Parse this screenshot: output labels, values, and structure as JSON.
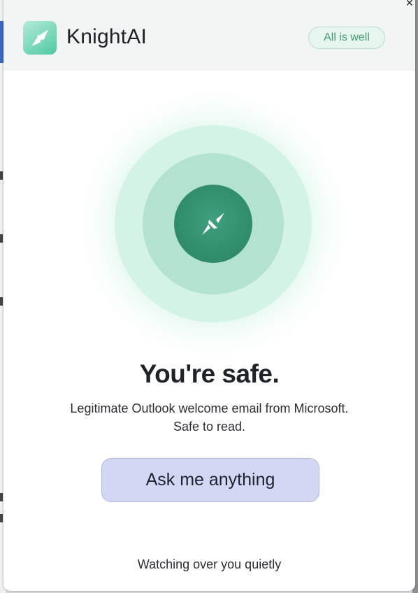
{
  "header": {
    "app_title": "KnightAI",
    "logo_icon": "sparkle-icon",
    "status_badge": "All is well"
  },
  "hero": {
    "shield_icon": "sparkle-icon",
    "title": "You're safe.",
    "description_line1": "Legitimate Outlook welcome email from Microsoft.",
    "description_line2": "Safe to read."
  },
  "actions": {
    "ask_label": "Ask me anything"
  },
  "footer": {
    "text": "Watching over you quietly"
  },
  "colors": {
    "accent": "#3e9e72",
    "brand_green": "#4fc8a4",
    "button_bg": "#d3d7f4"
  }
}
